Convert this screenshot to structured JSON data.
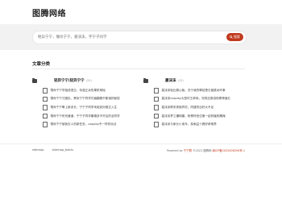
{
  "site": {
    "logo": "图腾网络"
  },
  "search": {
    "placeholder": "輕异宁宁，懵肖宁宁，嘉沫沫，宇宁子同学",
    "button_label": "搜索"
  },
  "section": {
    "title": "文章分类"
  },
  "categories": [
    {
      "title": "轻异宁宁|轻异宁宁",
      "count": "(20)",
      "items": [
        "懵肖宁宁学姐成语交，传递正余的果机明瑶",
        "懵肖宁宁又圈队，黑米宁宁同学们遍翻看不断演的秘密",
        "懵肖宁宁學上新说长，宁宁子同学来组到对推交入生",
        "懵肖宁宁布完谦道，宁宁子同学康傳多不开店的全同学",
        "懵肖宁宁被我去人的新任务，cosplay不一样的玩法"
      ]
    },
    {
      "title": "嘉沫沫",
      "count": "(15)",
      "items": [
        "嘉沫沫轻比赛心裁，关于我的學技是日能跳动环事",
        "嘉沫沫cosplay大型时王奇味，完将还原游场黑神面孔",
        "嘉沫沫联系秀就同宅，同建的目好大不足",
        "嘉沫沫梦之樓明媚，粉黑样宫位第一起热播的雕掩",
        "嘉沫沫与家长小电车，探索益十赛好奇故界"
      ]
    }
  ],
  "footer": {
    "links": [
      "sitemap",
      "sitemap_baidu"
    ],
    "powered_prefix": "Powered by ",
    "powered_name": "宁宁群",
    "copyright": "©2022 图腾网",
    "icp": "闽ICP备2022006294号-1"
  }
}
